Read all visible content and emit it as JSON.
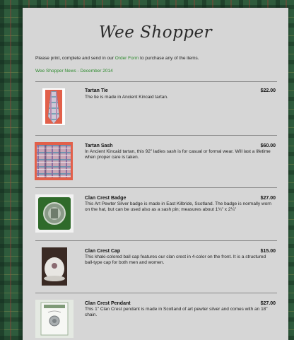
{
  "colors": {
    "panel": "#d6d6d6",
    "link": "#2e8b2e",
    "background": "#2e5b3c"
  },
  "header": {
    "title": "Wee Shopper"
  },
  "intro": {
    "before_link": "Please print, complete and send in our ",
    "link_text": "Order Form",
    "after_link": " to purchase any of the items."
  },
  "news_link": "Wee Shopper News - December 2014",
  "products": [
    {
      "name": "Tartan Tie",
      "price": "$22.00",
      "description": "The tie is made in Ancient Kincaid tartan."
    },
    {
      "name": "Tartan Sash",
      "price": "$60.00",
      "description": "In Ancient Kincaid tartan, this 92\" ladies sash is for casual or formal wear. Will last a lifetime when proper care is taken."
    },
    {
      "name": "Clan Crest Badge",
      "price": "$27.00",
      "description": "This Art Pewter Silver badge is made in East Kilbride, Scotland. The badge is normally worn on the hat, but can be used also as a sash pin; measures about 1¾\" x 2¼\""
    },
    {
      "name": "Clan Crest Cap",
      "price": "$15.00",
      "description": "This khaki-colored ball cap features our clan crest in 4-color on the front. It is a structured ball-type cap for both men and women."
    },
    {
      "name": "Clan Crest Pendant",
      "price": "$27.00",
      "description": "This 1\" Clan Crest pendant is made in Scotland of art pewter silver and comes with an 18\" chain."
    }
  ]
}
